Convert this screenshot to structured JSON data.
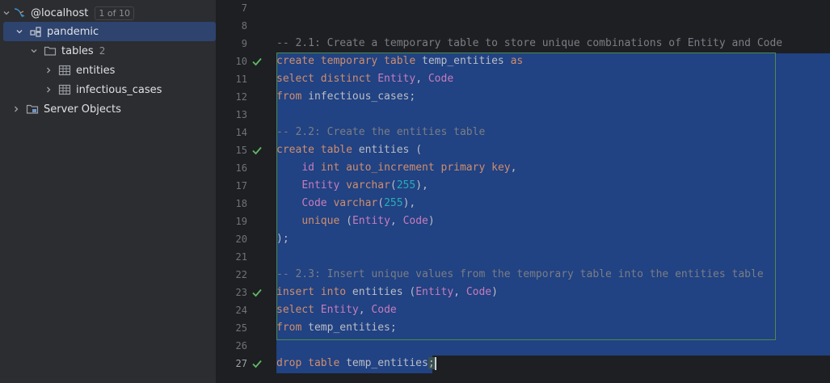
{
  "sidebar": {
    "host": {
      "label": "@localhost",
      "badge": "1 of 10"
    },
    "schema": {
      "label": "pandemic"
    },
    "tables": {
      "label": "tables",
      "count": "2"
    },
    "items": [
      {
        "label": "entities"
      },
      {
        "label": "infectious_cases"
      }
    ],
    "server_objects": {
      "label": "Server Objects"
    }
  },
  "editor": {
    "line_numbers": [
      "7",
      "8",
      "9",
      "10",
      "11",
      "12",
      "13",
      "14",
      "15",
      "16",
      "17",
      "18",
      "19",
      "20",
      "21",
      "22",
      "23",
      "24",
      "25",
      "26",
      "27"
    ],
    "lines": [
      [],
      [],
      [
        [
          "cm",
          "-- 2.1: Create a temporary table to store unique combinations of Entity and Code"
        ]
      ],
      [
        [
          "kw",
          "create temporary table "
        ],
        [
          "id",
          "temp_entities "
        ],
        [
          "kw",
          "as"
        ]
      ],
      [
        [
          "kw",
          "select distinct "
        ],
        [
          "fld",
          "Entity"
        ],
        [
          "id",
          ", "
        ],
        [
          "fld",
          "Code"
        ]
      ],
      [
        [
          "kw",
          "from "
        ],
        [
          "id",
          "infectious_cases;"
        ]
      ],
      [],
      [
        [
          "cm",
          "-- 2.2: Create the entities table"
        ]
      ],
      [
        [
          "kw",
          "create table "
        ],
        [
          "id",
          "entities ("
        ]
      ],
      [
        [
          "id",
          "    "
        ],
        [
          "fld",
          "id "
        ],
        [
          "kw",
          "int auto_increment primary key"
        ],
        [
          "id",
          ","
        ]
      ],
      [
        [
          "id",
          "    "
        ],
        [
          "fld",
          "Entity "
        ],
        [
          "kw",
          "varchar"
        ],
        [
          "id",
          "("
        ],
        [
          "num",
          "255"
        ],
        [
          "id",
          "),"
        ]
      ],
      [
        [
          "id",
          "    "
        ],
        [
          "fld",
          "Code "
        ],
        [
          "kw",
          "varchar"
        ],
        [
          "id",
          "("
        ],
        [
          "num",
          "255"
        ],
        [
          "id",
          "),"
        ]
      ],
      [
        [
          "id",
          "    "
        ],
        [
          "kw",
          "unique "
        ],
        [
          "id",
          "("
        ],
        [
          "fld",
          "Entity"
        ],
        [
          "id",
          ", "
        ],
        [
          "fld",
          "Code"
        ],
        [
          "id",
          ")"
        ]
      ],
      [
        [
          "id",
          ");"
        ]
      ],
      [],
      [
        [
          "cm",
          "-- 2.3: Insert unique values from the temporary table into the entities table"
        ]
      ],
      [
        [
          "kw",
          "insert into "
        ],
        [
          "id",
          "entities ("
        ],
        [
          "fld",
          "Entity"
        ],
        [
          "id",
          ", "
        ],
        [
          "fld",
          "Code"
        ],
        [
          "id",
          ")"
        ]
      ],
      [
        [
          "kw",
          "select "
        ],
        [
          "fld",
          "Entity"
        ],
        [
          "id",
          ", "
        ],
        [
          "fld",
          "Code"
        ]
      ],
      [
        [
          "kw",
          "from "
        ],
        [
          "id",
          "temp_entities;"
        ]
      ],
      [],
      [
        [
          "kw",
          "drop table "
        ],
        [
          "id",
          "temp_entities"
        ],
        [
          "semi",
          ";"
        ]
      ]
    ],
    "executed_lines": [
      "10",
      "15",
      "23",
      "27"
    ],
    "current_line": "27",
    "colors": {
      "keyword": "#cf8e6d",
      "comment": "#7a7e85",
      "field": "#c77dbb",
      "number": "#2aacb8",
      "selection": "#214283",
      "success": "#5fb865"
    }
  }
}
